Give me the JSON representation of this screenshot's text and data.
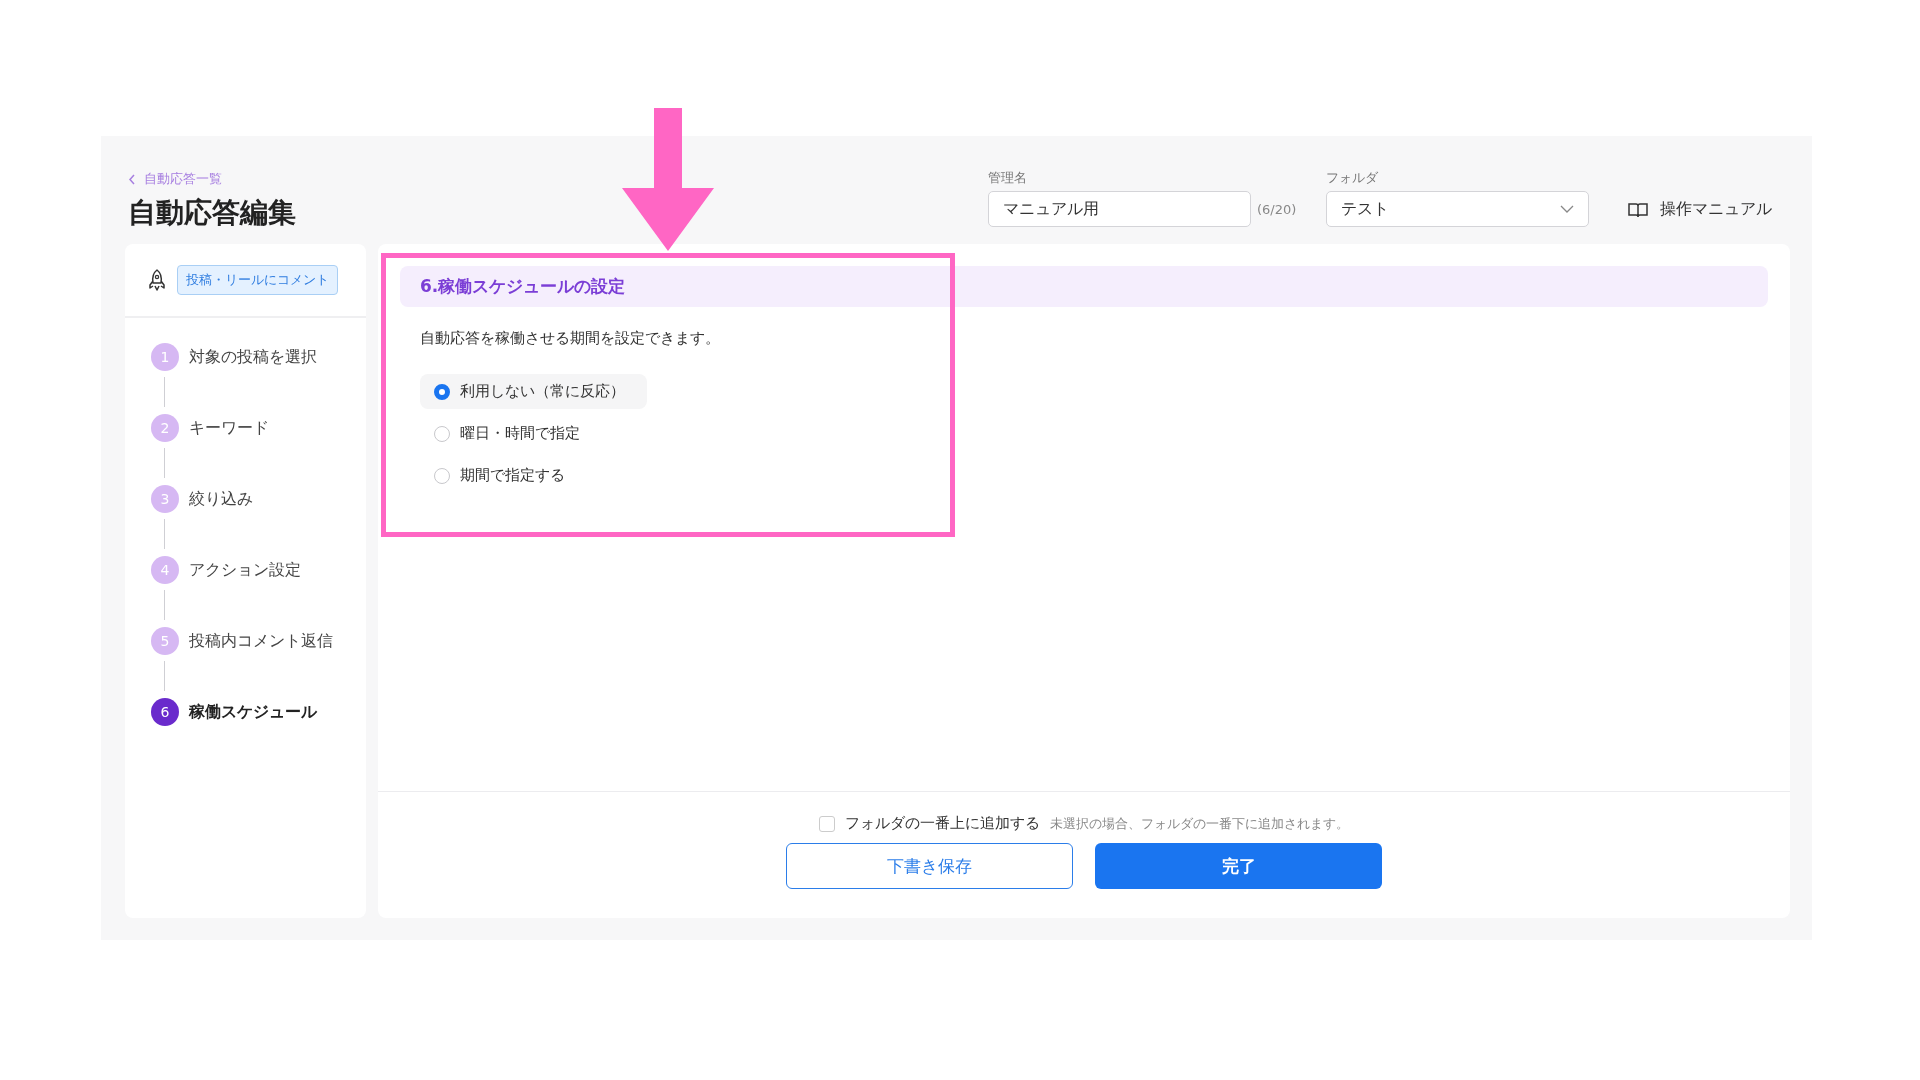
{
  "breadcrumb": {
    "label": "自動応答一覧"
  },
  "title": "自動応答編集",
  "name_field": {
    "label": "管理名",
    "value": "マニュアル用",
    "count": "(6/20)"
  },
  "folder_field": {
    "label": "フォルダ",
    "value": "テスト"
  },
  "manual_link": "操作マニュアル",
  "trigger_badge": "投稿・リールにコメント",
  "steps": [
    {
      "number": "1",
      "label": "対象の投稿を選択",
      "selected": false
    },
    {
      "number": "2",
      "label": "キーワード",
      "selected": false
    },
    {
      "number": "3",
      "label": "絞り込み",
      "selected": false
    },
    {
      "number": "4",
      "label": "アクション設定",
      "selected": false
    },
    {
      "number": "5",
      "label": "投稿内コメント返信",
      "selected": false
    },
    {
      "number": "6",
      "label": "稼働スケジュール",
      "selected": true
    }
  ],
  "section": {
    "title": "6.稼働スケジュールの設定",
    "description": "自動応答を稼働させる期間を設定できます。",
    "options": [
      {
        "label": "利用しない（常に反応）",
        "selected": true
      },
      {
        "label": "曜日・時間で指定",
        "selected": false
      },
      {
        "label": "期間で指定する",
        "selected": false
      }
    ]
  },
  "footer": {
    "add_to_top": {
      "label": "フォルダの一番上に追加する",
      "checked": false,
      "hint": "未選択の場合、フォルダの一番下に追加されます。"
    },
    "buttons": [
      {
        "label": "下書き保存",
        "kind": "secondary"
      },
      {
        "label": "完了",
        "kind": "primary"
      }
    ]
  }
}
